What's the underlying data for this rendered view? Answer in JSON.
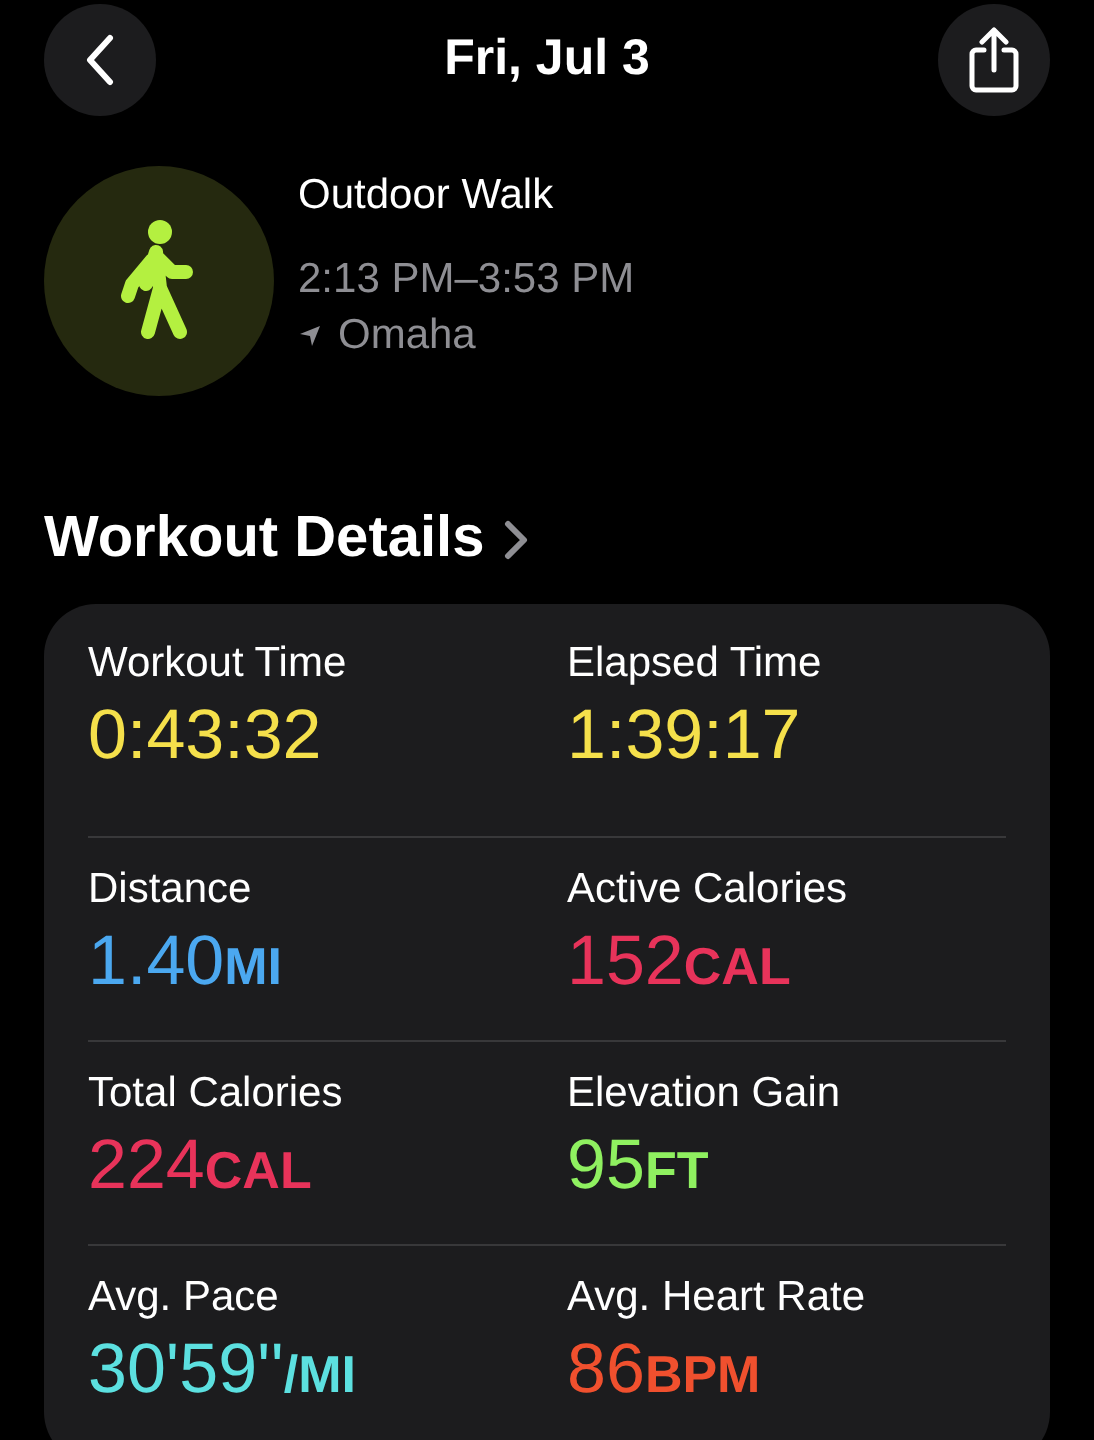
{
  "header": {
    "title": "Fri, Jul 3"
  },
  "workout": {
    "name": "Outdoor Walk",
    "time_range": "2:13 PM–3:53 PM",
    "location": "Omaha"
  },
  "section": {
    "title": "Workout Details"
  },
  "metrics": [
    {
      "label": "Workout Time",
      "value": "0:43:32",
      "color": "#f5e04b"
    },
    {
      "label": "Elapsed Time",
      "value": "1:39:17",
      "color": "#f5e04b"
    },
    {
      "label": "Distance",
      "value": "1.40",
      "unit": "MI",
      "color": "#4ba8f0"
    },
    {
      "label": "Active Calories",
      "value": "152",
      "unit": "CAL",
      "color": "#e8335a"
    },
    {
      "label": "Total Calories",
      "value": "224",
      "unit": "CAL",
      "color": "#e8335a"
    },
    {
      "label": "Elevation Gain",
      "value": "95",
      "unit": "FT",
      "color": "#8ff060"
    },
    {
      "label": "Avg. Pace",
      "value": "30'59''",
      "unit": "/MI",
      "color": "#5ce0e0"
    },
    {
      "label": "Avg. Heart Rate",
      "value": "86",
      "unit": "BPM",
      "color": "#f0502e"
    }
  ]
}
